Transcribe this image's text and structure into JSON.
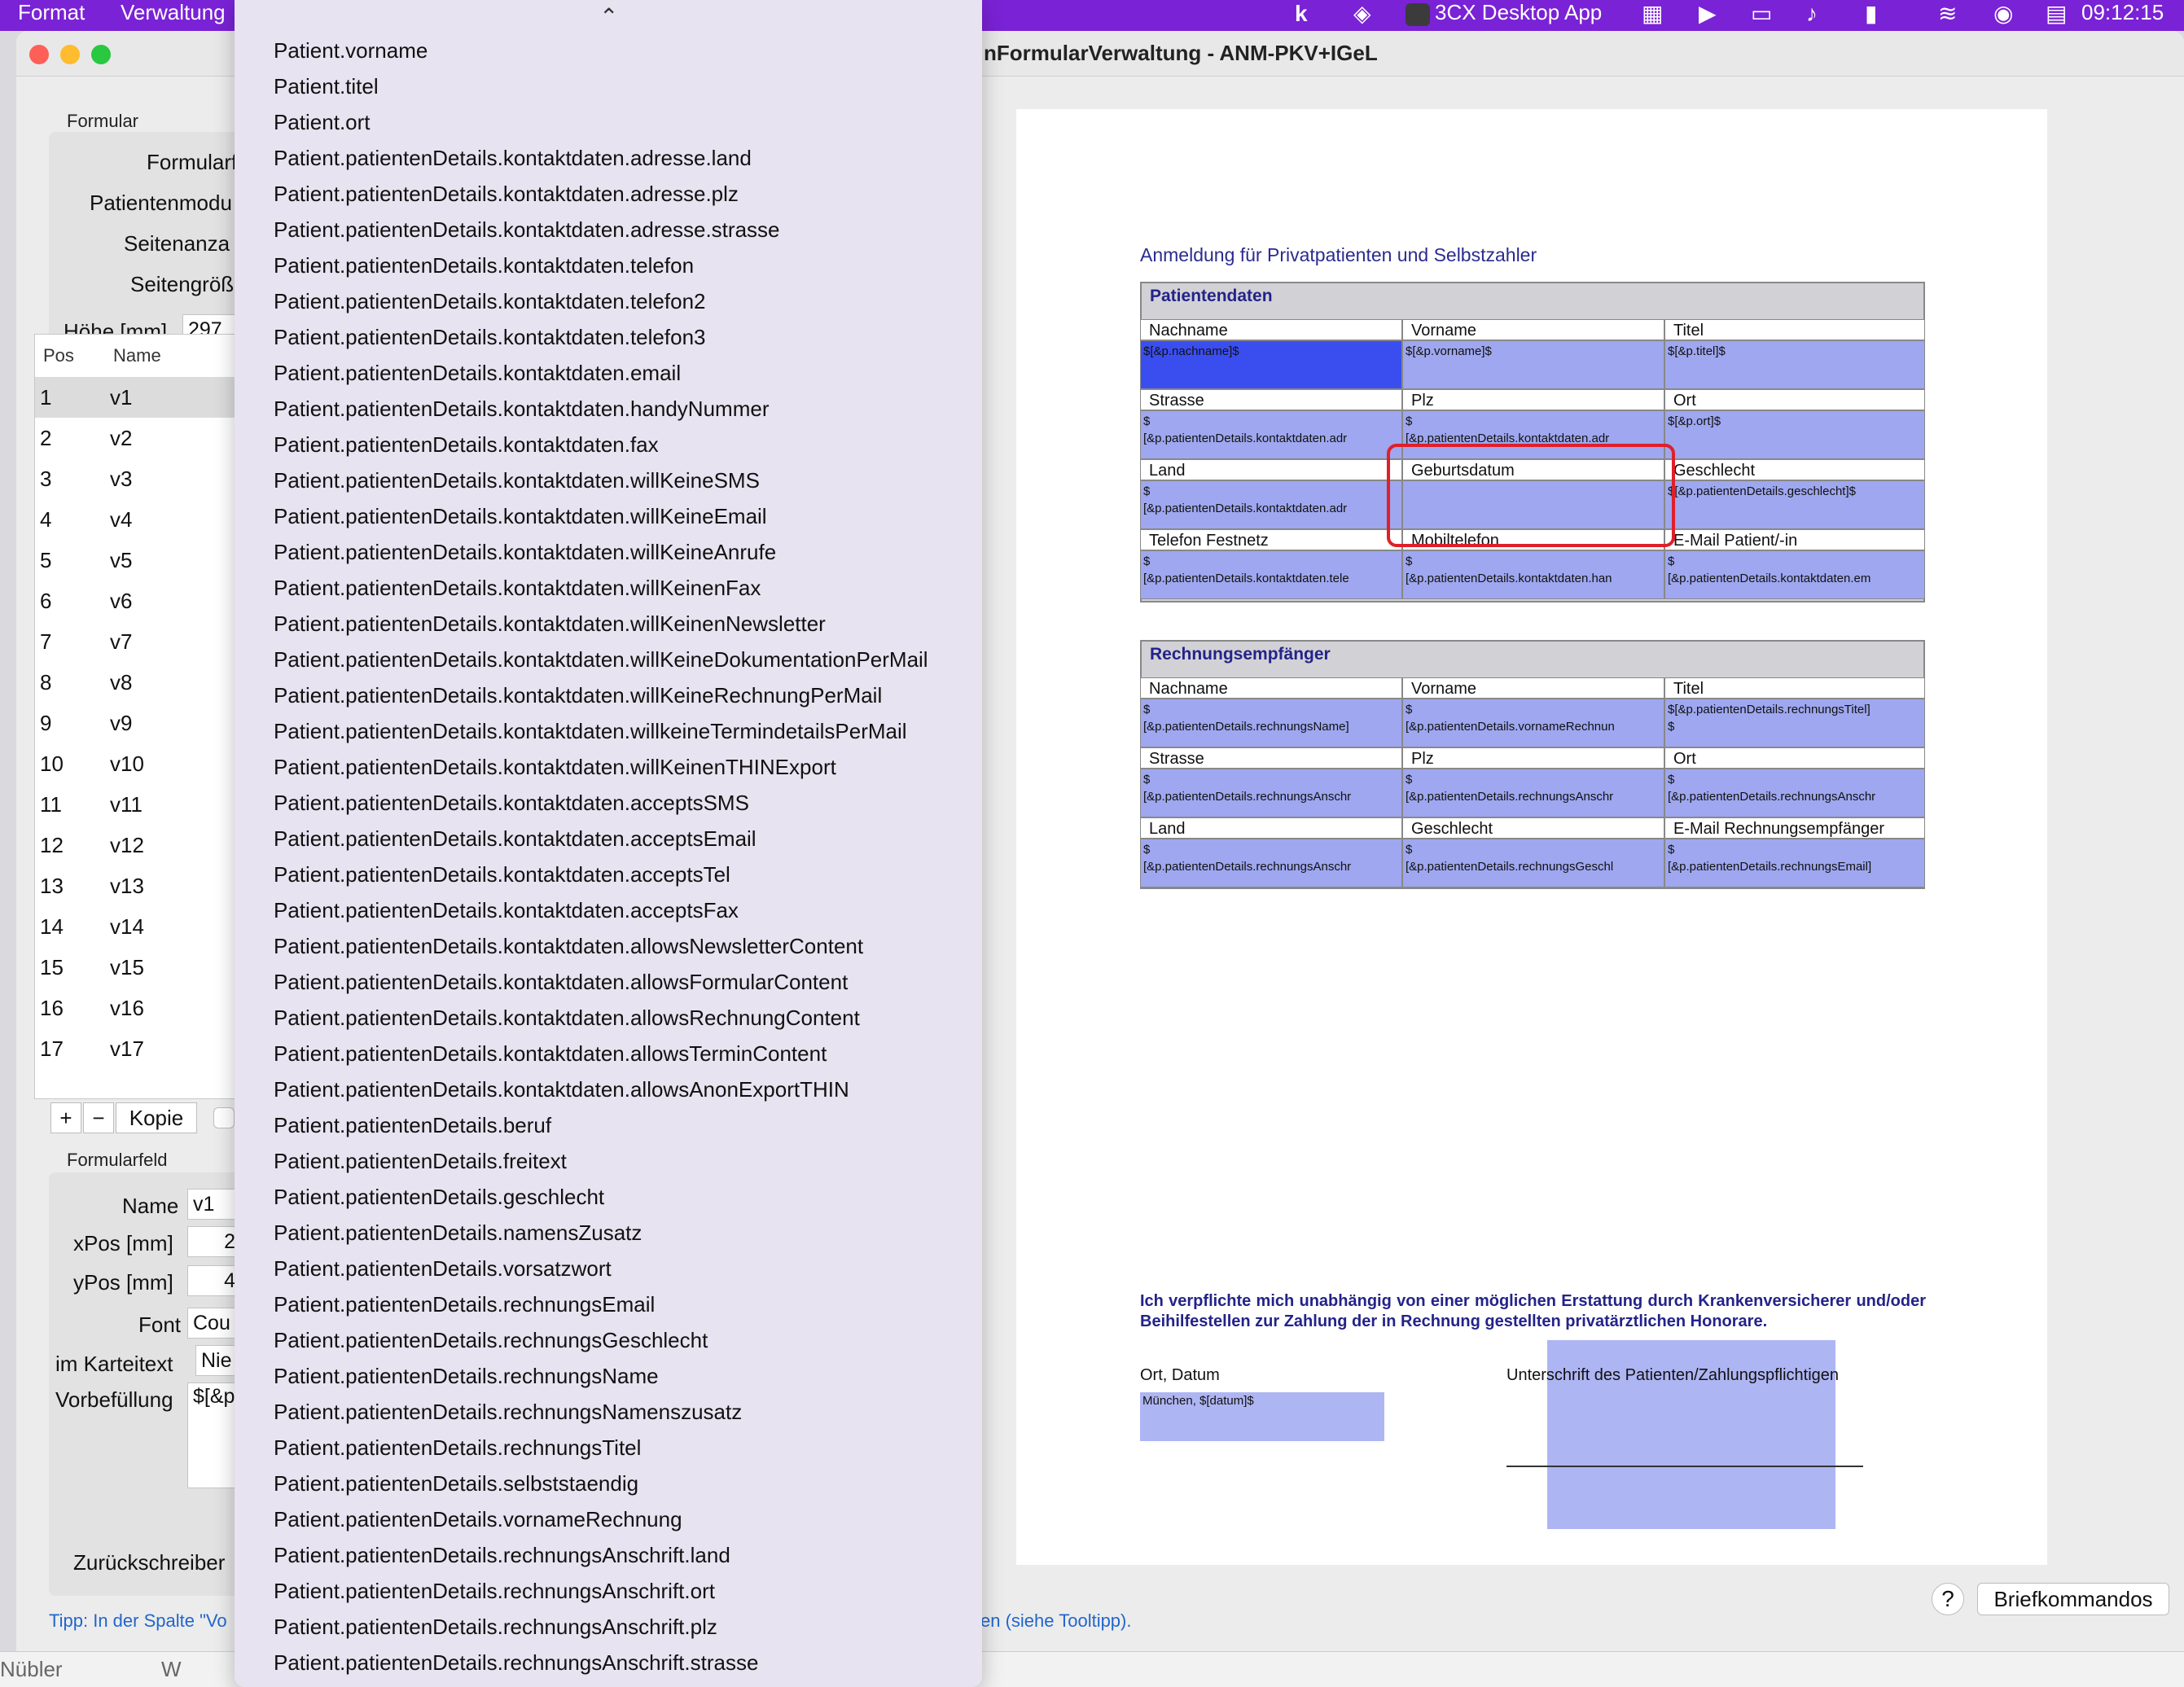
{
  "menubar": {
    "items": [
      "Format",
      "Verwaltung"
    ],
    "app_name": "3CX Desktop App",
    "clock": "09:12:15"
  },
  "window": {
    "title": "nFormularVerwaltung - ANM-PKV+IGeL"
  },
  "left": {
    "formular_group": "Formular",
    "fields": [
      {
        "label": "Formularfarb"
      },
      {
        "label": "Patientenmodu"
      },
      {
        "label": "Seitenanza"
      },
      {
        "label": "Seitengröß"
      },
      {
        "label": "Höhe [mm]",
        "value": "297"
      }
    ],
    "table": {
      "headers": [
        "Pos",
        "Name"
      ],
      "rows": [
        {
          "pos": "1",
          "name": "v1"
        },
        {
          "pos": "2",
          "name": "v2"
        },
        {
          "pos": "3",
          "name": "v3"
        },
        {
          "pos": "4",
          "name": "v4"
        },
        {
          "pos": "5",
          "name": "v5"
        },
        {
          "pos": "6",
          "name": "v6"
        },
        {
          "pos": "7",
          "name": "v7"
        },
        {
          "pos": "8",
          "name": "v8"
        },
        {
          "pos": "9",
          "name": "v9"
        },
        {
          "pos": "10",
          "name": "v10"
        },
        {
          "pos": "11",
          "name": "v11"
        },
        {
          "pos": "12",
          "name": "v12"
        },
        {
          "pos": "13",
          "name": "v13"
        },
        {
          "pos": "14",
          "name": "v14"
        },
        {
          "pos": "15",
          "name": "v15"
        },
        {
          "pos": "16",
          "name": "v16"
        },
        {
          "pos": "17",
          "name": "v17"
        }
      ]
    },
    "buttons": {
      "add": "+",
      "remove": "−",
      "copy": "Kopie"
    },
    "formularfeld_group": "Formularfeld",
    "feld": [
      {
        "label": "Name",
        "value": "v1"
      },
      {
        "label": "xPos [mm]",
        "value": "2"
      },
      {
        "label": "yPos [mm]",
        "value": "4"
      },
      {
        "label": "Font",
        "value": "Cou"
      },
      {
        "label": "im Karteitext",
        "value": "Nie"
      },
      {
        "label": "Vorbefüllung",
        "value": "$[&p"
      }
    ],
    "zurueck_label": "Zurückschreiber",
    "tip": "Tipp: In der Spalte \"Vo",
    "tip_end": "en (siehe Tooltipp)."
  },
  "document": {
    "title": "Anmeldung für Privatpatienten und Selbstzahler",
    "patient_section": "Patientendaten",
    "patient_rows": [
      {
        "headers": [
          "Nachname",
          "Vorname",
          "Titel"
        ],
        "values": [
          "$[&p.nachname]$",
          "$[&p.vorname]$",
          "$[&p.titel]$"
        ]
      },
      {
        "headers": [
          "Strasse",
          "Plz",
          "Ort"
        ],
        "values": [
          "$\n[&p.patientenDetails.kontaktdaten.adr",
          "$\n[&p.patientenDetails.kontaktdaten.adr",
          "$[&p.ort]$"
        ]
      },
      {
        "headers": [
          "Land",
          "Geburtsdatum",
          "Geschlecht"
        ],
        "values": [
          "$\n[&p.patientenDetails.kontaktdaten.adr",
          "",
          "$[&p.patientenDetails.geschlecht]$"
        ]
      },
      {
        "headers": [
          "Telefon Festnetz",
          "Mobiltelefon",
          "E-Mail Patient/-in"
        ],
        "values": [
          "$\n[&p.patientenDetails.kontaktdaten.tele",
          "$\n[&p.patientenDetails.kontaktdaten.han",
          "$\n[&p.patientenDetails.kontaktdaten.em"
        ]
      }
    ],
    "rechnung_section": "Rechnungsempfänger",
    "rechnung_rows": [
      {
        "headers": [
          "Nachname",
          "Vorname",
          "Titel"
        ],
        "values": [
          "$\n[&p.patientenDetails.rechnungsName]",
          "$\n[&p.patientenDetails.vornameRechnun",
          "$[&p.patientenDetails.rechnungsTitel]\n$"
        ]
      },
      {
        "headers": [
          "Strasse",
          "Plz",
          "Ort"
        ],
        "values": [
          "$\n[&p.patientenDetails.rechnungsAnschr",
          "$\n[&p.patientenDetails.rechnungsAnschr",
          "$\n[&p.patientenDetails.rechnungsAnschr"
        ]
      },
      {
        "headers": [
          "Land",
          "Geschlecht",
          "E-Mail Rechnungsempfänger"
        ],
        "values": [
          "$\n[&p.patientenDetails.rechnungsAnschr",
          "$\n[&p.patientenDetails.rechnungsGeschl",
          "$\n[&p.patientenDetails.rechnungsEmail]"
        ]
      }
    ],
    "verpflichtung": "Ich verpflichte mich unabhängig von einer möglichen Erstattung durch Krankenversicherer und/oder Beihilfestellen zur Zahlung der in Rechnung gestellten privatärztlichen Honorare.",
    "ort_datum_label": "Ort, Datum",
    "ort_datum_value": "München, $[datum]$",
    "unterschrift_label": "Unterschrift des Patienten/Zahlungspflichtigen"
  },
  "bottom": {
    "help": "?",
    "briefkommandos": "Briefkommandos",
    "strip_left": "Nübler",
    "strip_w": "W"
  },
  "dropdown": {
    "items": [
      "Patient.vorname",
      "Patient.titel",
      "Patient.ort",
      "Patient.patientenDetails.kontaktdaten.adresse.land",
      "Patient.patientenDetails.kontaktdaten.adresse.plz",
      "Patient.patientenDetails.kontaktdaten.adresse.strasse",
      "Patient.patientenDetails.kontaktdaten.telefon",
      "Patient.patientenDetails.kontaktdaten.telefon2",
      "Patient.patientenDetails.kontaktdaten.telefon3",
      "Patient.patientenDetails.kontaktdaten.email",
      "Patient.patientenDetails.kontaktdaten.handyNummer",
      "Patient.patientenDetails.kontaktdaten.fax",
      "Patient.patientenDetails.kontaktdaten.willKeineSMS",
      "Patient.patientenDetails.kontaktdaten.willKeineEmail",
      "Patient.patientenDetails.kontaktdaten.willKeineAnrufe",
      "Patient.patientenDetails.kontaktdaten.willKeinenFax",
      "Patient.patientenDetails.kontaktdaten.willKeinenNewsletter",
      "Patient.patientenDetails.kontaktdaten.willKeineDokumentationPerMail",
      "Patient.patientenDetails.kontaktdaten.willKeineRechnungPerMail",
      "Patient.patientenDetails.kontaktdaten.willkeineTermindetailsPerMail",
      "Patient.patientenDetails.kontaktdaten.willKeinenTHINExport",
      "Patient.patientenDetails.kontaktdaten.acceptsSMS",
      "Patient.patientenDetails.kontaktdaten.acceptsEmail",
      "Patient.patientenDetails.kontaktdaten.acceptsTel",
      "Patient.patientenDetails.kontaktdaten.acceptsFax",
      "Patient.patientenDetails.kontaktdaten.allowsNewsletterContent",
      "Patient.patientenDetails.kontaktdaten.allowsFormularContent",
      "Patient.patientenDetails.kontaktdaten.allowsRechnungContent",
      "Patient.patientenDetails.kontaktdaten.allowsTerminContent",
      "Patient.patientenDetails.kontaktdaten.allowsAnonExportTHIN",
      "Patient.patientenDetails.beruf",
      "Patient.patientenDetails.freitext",
      "Patient.patientenDetails.geschlecht",
      "Patient.patientenDetails.namensZusatz",
      "Patient.patientenDetails.vorsatzwort",
      "Patient.patientenDetails.rechnungsEmail",
      "Patient.patientenDetails.rechnungsGeschlecht",
      "Patient.patientenDetails.rechnungsName",
      "Patient.patientenDetails.rechnungsNamenszusatz",
      "Patient.patientenDetails.rechnungsTitel",
      "Patient.patientenDetails.selbststaendig",
      "Patient.patientenDetails.vornameRechnung",
      "Patient.patientenDetails.rechnungsAnschrift.land",
      "Patient.patientenDetails.rechnungsAnschrift.ort",
      "Patient.patientenDetails.rechnungsAnschrift.plz",
      "Patient.patientenDetails.rechnungsAnschrift.strasse"
    ]
  }
}
